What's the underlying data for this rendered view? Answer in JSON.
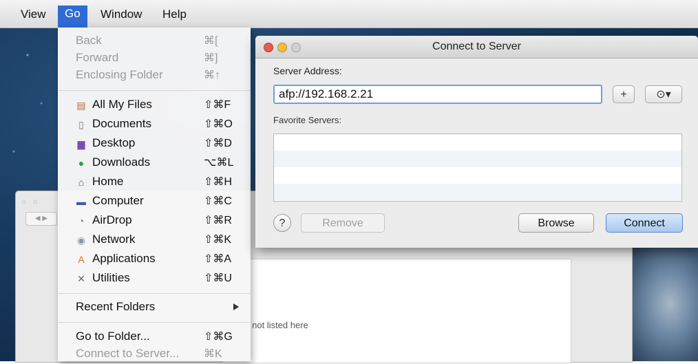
{
  "menubar": {
    "items": [
      "View",
      "Go",
      "Window",
      "Help"
    ]
  },
  "go_menu": {
    "items": [
      {
        "label": "Back",
        "shortcut": "⌘[",
        "enabled": false
      },
      {
        "label": "Forward",
        "shortcut": "⌘]",
        "enabled": false
      },
      {
        "label": "Enclosing Folder",
        "shortcut": "⌘↑",
        "enabled": false
      },
      {
        "label": "All My Files",
        "shortcut": "⇧⌘F",
        "icon": "all-my-files-icon"
      },
      {
        "label": "Documents",
        "shortcut": "⇧⌘O",
        "icon": "documents-icon"
      },
      {
        "label": "Desktop",
        "shortcut": "⇧⌘D",
        "icon": "desktop-icon"
      },
      {
        "label": "Downloads",
        "shortcut": "⌥⌘L",
        "icon": "downloads-icon"
      },
      {
        "label": "Home",
        "shortcut": "⇧⌘H",
        "icon": "home-icon"
      },
      {
        "label": "Computer",
        "shortcut": "⇧⌘C",
        "icon": "computer-icon"
      },
      {
        "label": "AirDrop",
        "shortcut": "⇧⌘R",
        "icon": "airdrop-icon"
      },
      {
        "label": "Network",
        "shortcut": "⇧⌘K",
        "icon": "network-icon"
      },
      {
        "label": "Applications",
        "shortcut": "⇧⌘A",
        "icon": "applications-icon"
      },
      {
        "label": "Utilities",
        "shortcut": "⇧⌘U",
        "icon": "utilities-icon"
      },
      {
        "label": "Recent Folders",
        "submenu": true
      },
      {
        "label": "Go to Folder...",
        "shortcut": "⇧⌘G"
      },
      {
        "label": "Connect to Server...",
        "shortcut": "⌘K",
        "enabled": false
      }
    ]
  },
  "dialog": {
    "title": "Connect to Server",
    "server_address_label": "Server Address:",
    "server_address_value": "afp://192.168.2.21",
    "add_button": "+",
    "recent_button": "⊙▾",
    "favorites_label": "Favorite Servers:",
    "help_button": "?",
    "remove_button": "Remove",
    "browse_button": "Browse",
    "connect_button": "Connect"
  },
  "background_window": {
    "hint_text": "s not listed here"
  },
  "colors": {
    "menu_highlight": "#2f6bd3",
    "input_focus": "#6f9de0",
    "default_button": "#a9c9ef"
  }
}
